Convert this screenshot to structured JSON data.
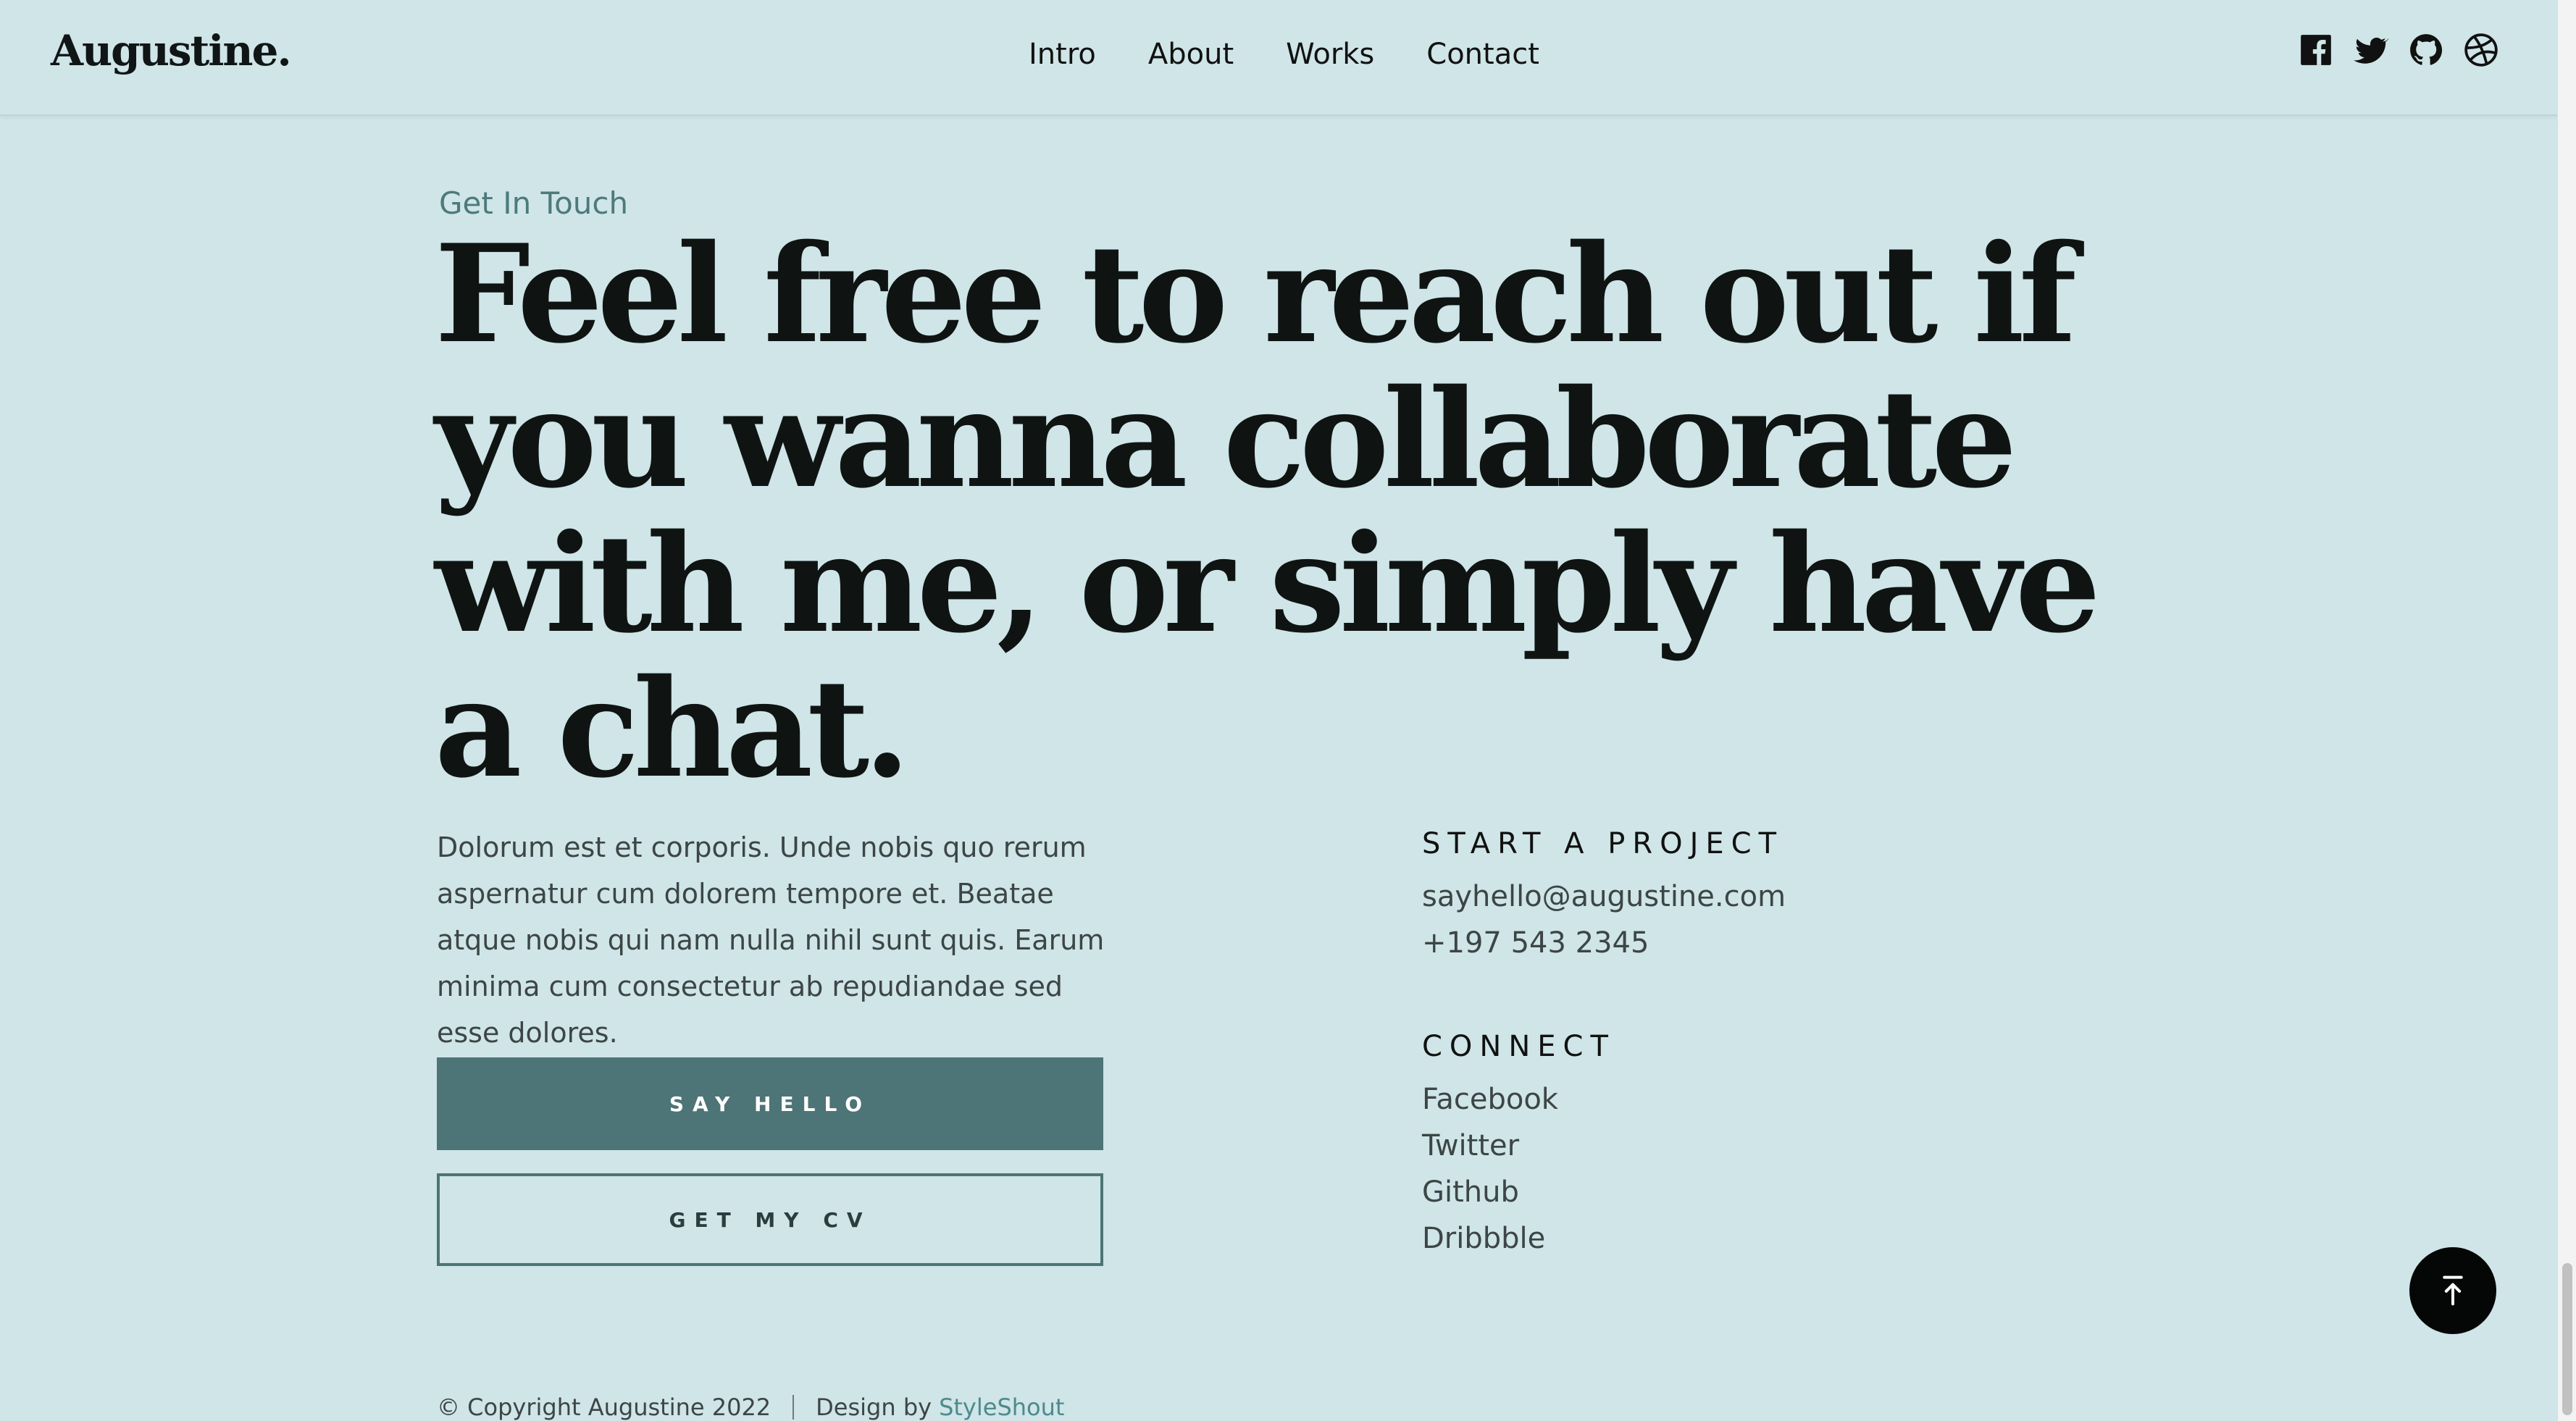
{
  "header": {
    "logo": "Augustine.",
    "nav": [
      "Intro",
      "About",
      "Works",
      "Contact"
    ],
    "social_icons": [
      "facebook-icon",
      "twitter-icon",
      "github-icon",
      "dribbble-icon"
    ]
  },
  "contact": {
    "kicker": "Get In Touch",
    "headline": "Feel free to reach out if you wanna collaborate with me, or simply have a chat.",
    "body": "Dolorum est et corporis. Unde nobis quo rerum aspernatur cum dolorem tempore et. Beatae atque nobis qui nam nulla nihil sunt quis. Earum minima cum consectetur ab repudiandae sed esse dolores.",
    "primary_button": "SAY HELLO",
    "secondary_button": "GET MY CV"
  },
  "project": {
    "title": "START A PROJECT",
    "email": "sayhello@augustine.com",
    "phone": "+197 543 2345"
  },
  "connect": {
    "title": "CONNECT",
    "links": [
      "Facebook",
      "Twitter",
      "Github",
      "Dribbble"
    ]
  },
  "footer": {
    "copyright": "© Copyright Augustine 2022",
    "design_by": "Design by",
    "credit_link": "StyleShout"
  },
  "colors": {
    "background": "#cfe5e7",
    "accent": "#4d7476",
    "text": "#111111"
  }
}
